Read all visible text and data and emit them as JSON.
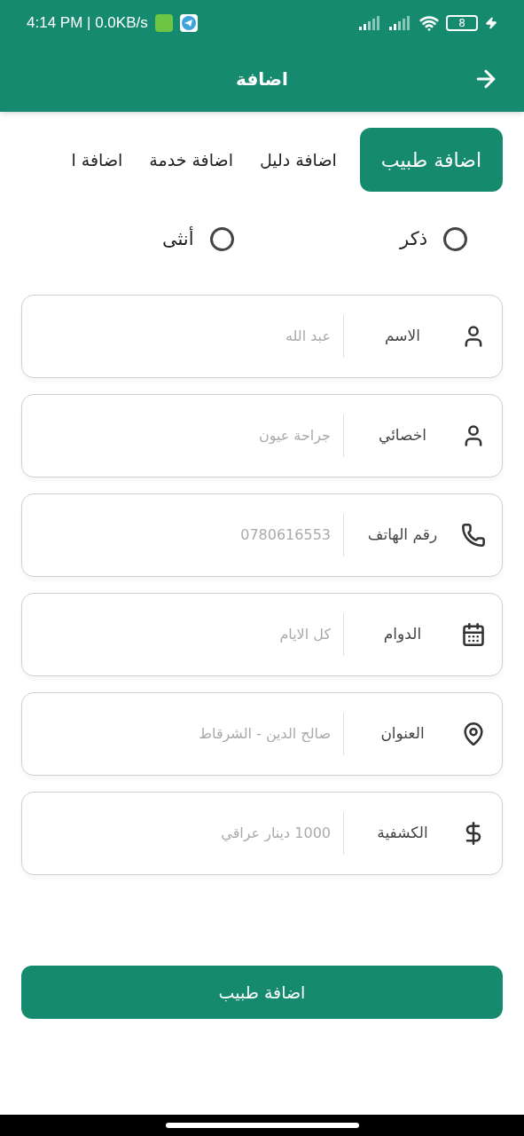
{
  "status_bar": {
    "time": "4:14 PM | 0.0KB/s",
    "battery": "8"
  },
  "header": {
    "title": "اضافة"
  },
  "tabs": [
    {
      "label": "اضافة طبيب",
      "selected": true
    },
    {
      "label": "اضافة دليل",
      "selected": false
    },
    {
      "label": "اضافة خدمة",
      "selected": false
    },
    {
      "label": "اضافة ا",
      "selected": false
    }
  ],
  "gender": [
    {
      "label": "ذكر",
      "selected": false
    },
    {
      "label": "أنثى",
      "selected": false
    }
  ],
  "fields": [
    {
      "kind": "person",
      "label": "الاسم",
      "placeholder": "عبد الله"
    },
    {
      "kind": "person",
      "label": "اخصائي",
      "placeholder": "جراحة عيون"
    },
    {
      "kind": "phone",
      "label": "رقم الهاتف",
      "placeholder": "0780616553"
    },
    {
      "kind": "calendar",
      "label": "الدوام",
      "placeholder": "كل الايام"
    },
    {
      "kind": "pin",
      "label": "العنوان",
      "placeholder": "صالح الدين - الشرقاط"
    },
    {
      "kind": "money",
      "label": "الكشفية",
      "placeholder": "1000 دينار عراقي"
    }
  ],
  "submit": "اضافة طبيب"
}
